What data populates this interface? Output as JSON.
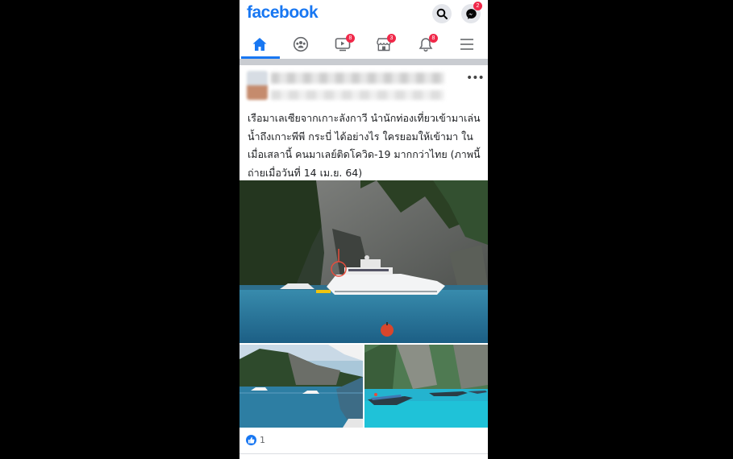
{
  "app": {
    "logo_text": "facebook",
    "brand_color": "#1877f2",
    "badge_color": "#f02849"
  },
  "header": {
    "search_icon": "search-icon",
    "messenger_icon": "messenger-icon",
    "messenger_badge": "2"
  },
  "tabs": [
    {
      "name": "home",
      "icon": "home-icon",
      "active": true,
      "badge": ""
    },
    {
      "name": "groups",
      "icon": "groups-icon",
      "active": false,
      "badge": ""
    },
    {
      "name": "watch",
      "icon": "watch-icon",
      "active": false,
      "badge": "8"
    },
    {
      "name": "marketplace",
      "icon": "marketplace-icon",
      "active": false,
      "badge": "3"
    },
    {
      "name": "notifications",
      "icon": "bell-icon",
      "active": false,
      "badge": "8"
    },
    {
      "name": "menu",
      "icon": "menu-icon",
      "active": false,
      "badge": ""
    }
  ],
  "post": {
    "more_label": "•••",
    "caption": "เรือมาเลเซียจากเกาะลังกาวี นำนักท่องเที่ยวเข้ามาเล่นน้ำถึงเกาะพีพี กระบี่ ได้อย่างไร ใครยอมให้เข้ามา ในเมื่อเสลานี้ คนมาเลย์ติดโควิด-19 มากกว่าไทย (ภาพนี้ถ่ายเมื่อวันที่ 14 เม.ย. 64)",
    "reaction_count": "1",
    "reaction_icon": "like-icon"
  }
}
